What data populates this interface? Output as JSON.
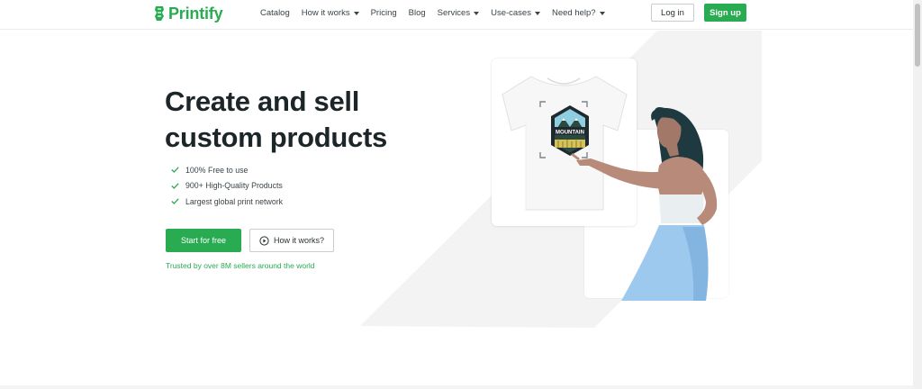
{
  "brand": {
    "name": "Printify",
    "color": "#29ab51"
  },
  "nav": {
    "items": [
      {
        "label": "Catalog",
        "has_caret": false
      },
      {
        "label": "How it works",
        "has_caret": true
      },
      {
        "label": "Pricing",
        "has_caret": false
      },
      {
        "label": "Blog",
        "has_caret": false
      },
      {
        "label": "Services",
        "has_caret": true
      },
      {
        "label": "Use-cases",
        "has_caret": true
      },
      {
        "label": "Need help?",
        "has_caret": true
      }
    ],
    "login_label": "Log in",
    "signup_label": "Sign up"
  },
  "hero": {
    "title_line1": "Create and sell",
    "title_line2": "custom products",
    "features": [
      "100% Free to use",
      "900+ High-Quality Products",
      "Largest global print network"
    ],
    "cta_primary": "Start for free",
    "cta_secondary": "How it works?",
    "trusted_text": "Trusted by over 8M sellers around the world"
  },
  "illustration": {
    "design_text": "MOUNTAIN"
  }
}
